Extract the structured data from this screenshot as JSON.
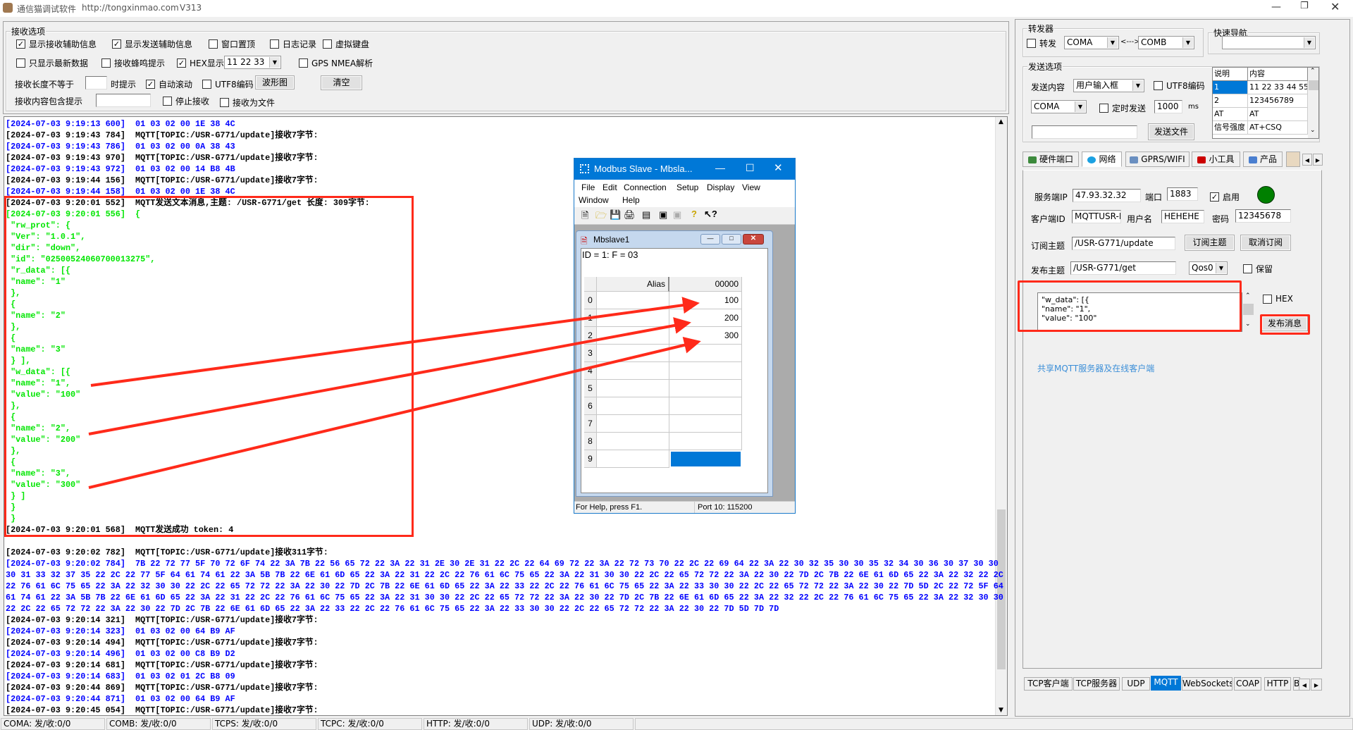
{
  "title": {
    "app": "通信猫调试软件",
    "url": "http://tongxinmao.com",
    "version": "V313"
  },
  "receive_options": {
    "group_label": "接收选项",
    "show_recv_info": {
      "label": "显示接收辅助信息",
      "checked": true
    },
    "show_send_info": {
      "label": "显示发送辅助信息",
      "checked": true
    },
    "window_top": {
      "label": "窗口置顶",
      "checked": false
    },
    "log_record": {
      "label": "日志记录",
      "checked": false
    },
    "virtual_keyboard": {
      "label": "虚拟键盘",
      "checked": false
    },
    "latest_only": {
      "label": "只显示最新数据",
      "checked": false
    },
    "beep": {
      "label": "接收蜂鸣提示",
      "checked": false
    },
    "hex_display": {
      "label": "HEX显示",
      "checked": true
    },
    "hex_format": "11 22 33",
    "gps": {
      "label": "GPS NMEA解析",
      "checked": false
    },
    "len_label": "接收长度不等于",
    "len_value": "",
    "len_suffix": "时提示",
    "auto_scroll": {
      "label": "自动滚动",
      "checked": true
    },
    "utf8": {
      "label": "UTF8编码",
      "checked": false
    },
    "waveform_button": "波形图",
    "clear_button": "清空",
    "contains_label": "接收内容包含提示",
    "contains_value": "",
    "stop_recv": {
      "label": "停止接收",
      "checked": false
    },
    "recv_to_file": {
      "label": "接收为文件",
      "checked": false
    }
  },
  "log": {
    "lines": [
      {
        "c": "b",
        "s": "[2024-07-03 9:19:13 600]  01 03 02 00 1E 38 4C"
      },
      {
        "c": "k",
        "s": "[2024-07-03 9:19:43 784]  MQTT[TOPIC:/USR-G771/update]接收7字节:"
      },
      {
        "c": "b",
        "s": "[2024-07-03 9:19:43 786]  01 03 02 00 0A 38 43"
      },
      {
        "c": "k",
        "s": "[2024-07-03 9:19:43 970]  MQTT[TOPIC:/USR-G771/update]接收7字节:"
      },
      {
        "c": "b",
        "s": "[2024-07-03 9:19:43 972]  01 03 02 00 14 B8 4B"
      },
      {
        "c": "k",
        "s": "[2024-07-03 9:19:44 156]  MQTT[TOPIC:/USR-G771/update]接收7字节:"
      },
      {
        "c": "b",
        "s": "[2024-07-03 9:19:44 158]  01 03 02 00 1E 38 4C"
      },
      {
        "c": "k",
        "s": "[2024-07-03 9:20:01 552]  MQTT发送文本消息,主题: /USR-G771/get 长度: 309字节:"
      },
      {
        "c": "g",
        "s": "[2024-07-03 9:20:01 556]  {"
      },
      {
        "c": "g",
        "s": " \"rw_prot\": {"
      },
      {
        "c": "g",
        "s": " \"Ver\": \"1.0.1\","
      },
      {
        "c": "g",
        "s": " \"dir\": \"down\","
      },
      {
        "c": "g",
        "s": " \"id\": \"02500524060700013275\","
      },
      {
        "c": "g",
        "s": " \"r_data\": [{"
      },
      {
        "c": "g",
        "s": " \"name\": \"1\""
      },
      {
        "c": "g",
        "s": " },"
      },
      {
        "c": "g",
        "s": " {"
      },
      {
        "c": "g",
        "s": " \"name\": \"2\""
      },
      {
        "c": "g",
        "s": " },"
      },
      {
        "c": "g",
        "s": " {"
      },
      {
        "c": "g",
        "s": " \"name\": \"3\""
      },
      {
        "c": "g",
        "s": " } ],"
      },
      {
        "c": "g",
        "s": " \"w_data\": [{"
      },
      {
        "c": "g",
        "s": " \"name\": \"1\","
      },
      {
        "c": "g",
        "s": " \"value\": \"100\""
      },
      {
        "c": "g",
        "s": " },"
      },
      {
        "c": "g",
        "s": " {"
      },
      {
        "c": "g",
        "s": " \"name\": \"2\","
      },
      {
        "c": "g",
        "s": " \"value\": \"200\""
      },
      {
        "c": "g",
        "s": " },"
      },
      {
        "c": "g",
        "s": " {"
      },
      {
        "c": "g",
        "s": " \"name\": \"3\","
      },
      {
        "c": "g",
        "s": " \"value\": \"300\""
      },
      {
        "c": "g",
        "s": " } ]"
      },
      {
        "c": "g",
        "s": " }"
      },
      {
        "c": "g",
        "s": " }"
      },
      {
        "c": "k",
        "s": "[2024-07-03 9:20:01 568]  MQTT发送成功 token: 4"
      },
      {
        "c": "k",
        "s": ""
      },
      {
        "c": "k",
        "s": "[2024-07-03 9:20:02 782]  MQTT[TOPIC:/USR-G771/update]接收311字节:"
      },
      {
        "c": "b",
        "s": "[2024-07-03 9:20:02 784]  7B 22 72 77 5F 70 72 6F 74 22 3A 7B 22 56 65 72 22 3A 22 31 2E 30 2E 31 22 2C 22 64 69 72 22 3A 22 72 73 70 22 2C 22 69 64 22 3A 22 30 32 35 30 30 35 32 34 30 36 30 37 30 30"
      },
      {
        "c": "b",
        "s": "30 31 33 32 37 35 22 2C 22 77 5F 64 61 74 61 22 3A 5B 7B 22 6E 61 6D 65 22 3A 22 31 22 2C 22 76 61 6C 75 65 22 3A 22 31 30 30 22 2C 22 65 72 72 22 3A 22 30 22 7D 2C 7B 22 6E 61 6D 65 22 3A 22 32 22 2C"
      },
      {
        "c": "b",
        "s": "22 76 61 6C 75 65 22 3A 22 32 30 30 22 2C 22 65 72 72 22 3A 22 30 22 7D 2C 7B 22 6E 61 6D 65 22 3A 22 33 22 2C 22 76 61 6C 75 65 22 3A 22 33 30 30 22 2C 22 65 72 72 22 3A 22 30 22 7D 5D 2C 22 72 5F 64"
      },
      {
        "c": "b",
        "s": "61 74 61 22 3A 5B 7B 22 6E 61 6D 65 22 3A 22 31 22 2C 22 76 61 6C 75 65 22 3A 22 31 30 30 22 2C 22 65 72 72 22 3A 22 30 22 7D 2C 7B 22 6E 61 6D 65 22 3A 22 32 22 2C 22 76 61 6C 75 65 22 3A 22 32 30 30"
      },
      {
        "c": "b",
        "s": "22 2C 22 65 72 72 22 3A 22 30 22 7D 2C 7B 22 6E 61 6D 65 22 3A 22 33 22 2C 22 76 61 6C 75 65 22 3A 22 33 30 30 22 2C 22 65 72 72 22 3A 22 30 22 7D 5D 7D 7D"
      },
      {
        "c": "k",
        "s": "[2024-07-03 9:20:14 321]  MQTT[TOPIC:/USR-G771/update]接收7字节:"
      },
      {
        "c": "b",
        "s": "[2024-07-03 9:20:14 323]  01 03 02 00 64 B9 AF"
      },
      {
        "c": "k",
        "s": "[2024-07-03 9:20:14 494]  MQTT[TOPIC:/USR-G771/update]接收7字节:"
      },
      {
        "c": "b",
        "s": "[2024-07-03 9:20:14 496]  01 03 02 00 C8 B9 D2"
      },
      {
        "c": "k",
        "s": "[2024-07-03 9:20:14 681]  MQTT[TOPIC:/USR-G771/update]接收7字节:"
      },
      {
        "c": "b",
        "s": "[2024-07-03 9:20:14 683]  01 03 02 01 2C B8 09"
      },
      {
        "c": "k",
        "s": "[2024-07-03 9:20:44 869]  MQTT[TOPIC:/USR-G771/update]接收7字节:"
      },
      {
        "c": "b",
        "s": "[2024-07-03 9:20:44 871]  01 03 02 00 64 B9 AF"
      },
      {
        "c": "k",
        "s": "[2024-07-03 9:20:45 054]  MQTT[TOPIC:/USR-G771/update]接收7字节:"
      }
    ]
  },
  "status_bar": [
    "COMA: 发/收:0/0",
    "COMB: 发/收:0/0",
    "TCPS: 发/收:0/0",
    "TCPC: 发/收:0/0",
    "HTTP: 发/收:0/0",
    "UDP: 发/收:0/0"
  ],
  "forwarder": {
    "group_label": "转发器",
    "enable": {
      "label": "转发",
      "checked": false
    },
    "port_a": "COMA",
    "arrow": "<--->",
    "port_b": "COMB"
  },
  "quick_nav": {
    "group_label": "快速导航",
    "value": ""
  },
  "send_options": {
    "group_label": "发送选项",
    "content_label": "发送内容",
    "content_value": "用户输入框",
    "utf8": {
      "label": "UTF8编码",
      "checked": false
    },
    "port": "COMA",
    "timed": {
      "label": "定时发送",
      "checked": false
    },
    "interval": "1000",
    "unit": "ms",
    "file_path": "",
    "send_file_button": "发送文件",
    "table": {
      "headers": [
        "说明",
        "内容"
      ],
      "rows": [
        [
          "1",
          "11 22 33 44 55"
        ],
        [
          "2",
          "123456789"
        ],
        [
          "AT",
          "AT"
        ],
        [
          "信号强度",
          "AT+CSQ"
        ]
      ],
      "selected_row": 0
    }
  },
  "top_tabs": [
    "硬件端口",
    "网络",
    "GPRS/WIFI",
    "小工具",
    "产品"
  ],
  "top_tabs_active": 1,
  "mqtt": {
    "server_ip_label": "服务端IP",
    "server_ip": "47.93.32.32",
    "port_label": "端口",
    "port": "1883",
    "enable": {
      "label": "启用",
      "checked": true
    },
    "status_color": "#008000",
    "client_id_label": "客户端ID",
    "client_id": "MQTTUSR-M",
    "username_label": "用户名",
    "username": "HEHEHE",
    "password_label": "密码",
    "password": "12345678",
    "sub_topic_label": "订阅主题",
    "sub_topic": "/USR-G771/update",
    "subscribe_button": "订阅主题",
    "unsubscribe_button": "取消订阅",
    "pub_topic_label": "发布主题",
    "pub_topic": "/USR-G771/get",
    "qos": "Qos0",
    "retain": {
      "label": "保留",
      "checked": false
    },
    "message_lines": [
      "\"w_data\": [{",
      "\"name\": \"1\",",
      "\"value\": \"100\""
    ],
    "hex": {
      "label": "HEX",
      "checked": false
    },
    "publish_button": "发布消息",
    "share_link": "共享MQTT服务器及在线客户端"
  },
  "bottom_tabs": [
    "TCP客户端",
    "TCP服务器",
    "UDP",
    "MQTT",
    "WebSockets",
    "COAP",
    "HTTP",
    "B"
  ],
  "bottom_tabs_active": 3,
  "modbus": {
    "title": "Modbus Slave - Mbsla...",
    "menu": [
      "File",
      "Edit",
      "Connection",
      "Setup",
      "Display",
      "View",
      "Window",
      "Help"
    ],
    "child_title": "Mbslave1",
    "info": "ID = 1: F = 03",
    "header_alias": "Alias",
    "header_addr": "00000",
    "rows": [
      {
        "n": "0",
        "v": "100"
      },
      {
        "n": "1",
        "v": "200"
      },
      {
        "n": "2",
        "v": "300"
      },
      {
        "n": "3",
        "v": ""
      },
      {
        "n": "4",
        "v": ""
      },
      {
        "n": "5",
        "v": ""
      },
      {
        "n": "6",
        "v": ""
      },
      {
        "n": "7",
        "v": ""
      },
      {
        "n": "8",
        "v": ""
      },
      {
        "n": "9",
        "v": ""
      }
    ],
    "selected_row": 9,
    "status_help": "For Help, press F1.",
    "status_port": "Port 10: 115200"
  },
  "colors": {
    "annotation": "#ff2a1a",
    "selection": "#0078d7"
  }
}
